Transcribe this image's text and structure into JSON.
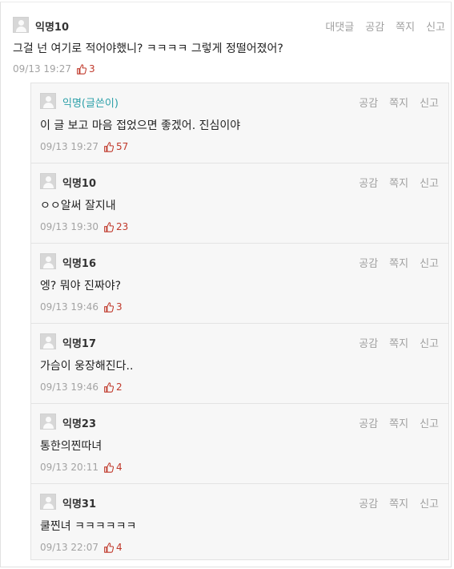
{
  "parent": {
    "nick": "익명10",
    "actions": [
      "대댓글",
      "공감",
      "쪽지",
      "신고"
    ],
    "text": "그걸 넌 여기로 적어야했니? ㅋㅋㅋㅋ 그렇게 정떨어졌어?",
    "time": "09/13 19:27",
    "likes": "3"
  },
  "reply_actions": [
    "공감",
    "쪽지",
    "신고"
  ],
  "replies": [
    {
      "nick": "익명(글쓴이)",
      "text": "이 글 보고 마음 접었으면 좋겠어. 진심이야",
      "time": "09/13 19:27",
      "likes": "57"
    },
    {
      "nick": "익명10",
      "text": "ㅇㅇ알써 잘지내",
      "time": "09/13 19:30",
      "likes": "23"
    },
    {
      "nick": "익명16",
      "text": "엥? 뭐야 진짜야?",
      "time": "09/13 19:46",
      "likes": "3"
    },
    {
      "nick": "익명17",
      "text": "가슴이 웅장해진다..",
      "time": "09/13 19:46",
      "likes": "2"
    },
    {
      "nick": "익명23",
      "text": "통한의찐따녀",
      "time": "09/13 20:11",
      "likes": "4"
    },
    {
      "nick": "익명31",
      "text": "쿨찐녀 ㅋㅋㅋㅋㅋㅋ",
      "time": "09/13 22:07",
      "likes": "4"
    }
  ],
  "colors": {
    "like": "#c0392b",
    "op_nick": "#2a9fa8",
    "reply_bg": "#f7f7f7"
  },
  "icons": {
    "avatar": "default-avatar-icon",
    "like": "thumbs-up-icon"
  }
}
